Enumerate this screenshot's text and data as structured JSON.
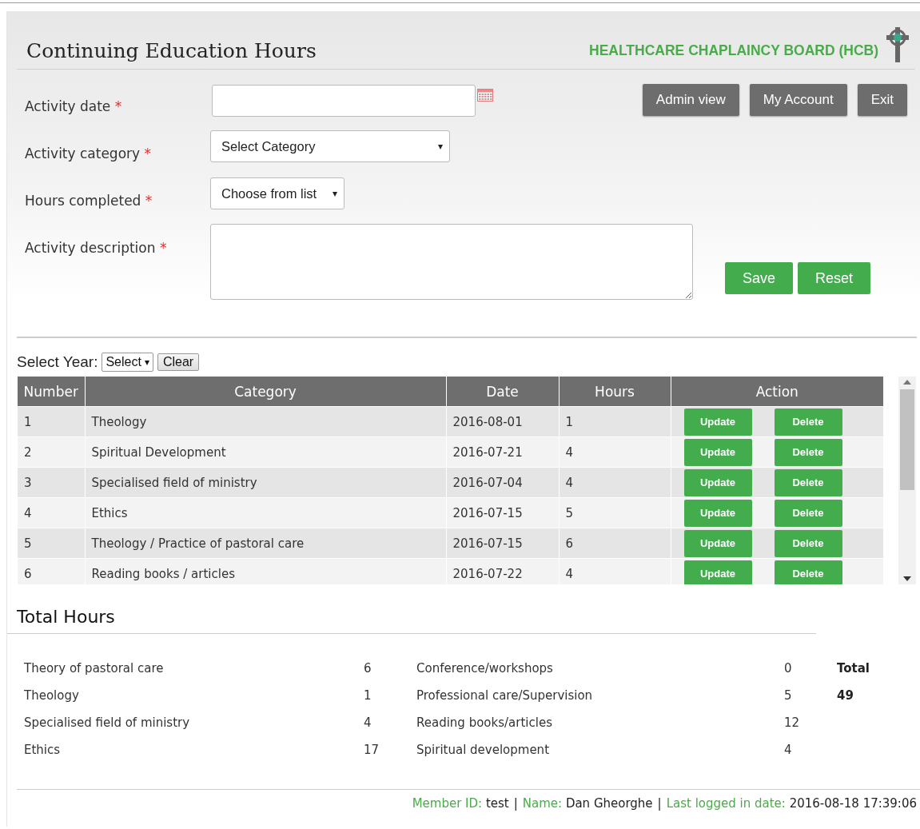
{
  "header": {
    "title": "Continuing Education Hours",
    "org_name": "HEALTHCARE CHAPLAINCY BOARD (HCB)"
  },
  "nav_buttons": [
    "Admin view",
    "My Account",
    "Exit"
  ],
  "form": {
    "fields": [
      {
        "kind": "date",
        "label": "Activity date",
        "required_mark": "*"
      },
      {
        "kind": "select",
        "label": "Activity category",
        "required_mark": "*",
        "value": "Select Category",
        "caret": "▾"
      },
      {
        "kind": "select_small",
        "label": "Hours completed",
        "required_mark": "*",
        "value": "Choose from list",
        "caret": "▾"
      },
      {
        "kind": "textarea",
        "label": "Activity description",
        "required_mark": "*"
      }
    ],
    "buttons": [
      "Save",
      "Reset"
    ]
  },
  "filter": {
    "label": "Select Year:",
    "select_value": "Select",
    "caret": "▾",
    "clear_button": "Clear"
  },
  "table": {
    "columns": [
      "Number",
      "Category",
      "Date",
      "Hours",
      "Action"
    ],
    "rows": [
      {
        "number": "1",
        "category": "Theology",
        "date": "2016-08-01",
        "hours": "1",
        "actions": [
          "Update",
          "Delete"
        ]
      },
      {
        "number": "2",
        "category": "Spiritual Development",
        "date": "2016-07-21",
        "hours": "4",
        "actions": [
          "Update",
          "Delete"
        ]
      },
      {
        "number": "3",
        "category": "Specialised field of ministry",
        "date": "2016-07-04",
        "hours": "4",
        "actions": [
          "Update",
          "Delete"
        ]
      },
      {
        "number": "4",
        "category": "Ethics",
        "date": "2016-07-15",
        "hours": "5",
        "actions": [
          "Update",
          "Delete"
        ]
      },
      {
        "number": "5",
        "category": "Theology / Practice of pastoral care",
        "date": "2016-07-15",
        "hours": "6",
        "actions": [
          "Update",
          "Delete"
        ]
      },
      {
        "number": "6",
        "category": "Reading books / articles",
        "date": "2016-07-22",
        "hours": "4",
        "actions": [
          "Update",
          "Delete"
        ]
      }
    ]
  },
  "totals": {
    "title": "Total Hours",
    "left": [
      {
        "label": "Theory of pastoral care",
        "value": "6"
      },
      {
        "label": "Theology",
        "value": "1"
      },
      {
        "label": "Specialised field of ministry",
        "value": "4"
      },
      {
        "label": "Ethics",
        "value": "17"
      }
    ],
    "right": [
      {
        "label": "Conference/workshops",
        "value": "0"
      },
      {
        "label": "Professional care/Supervision",
        "value": "5"
      },
      {
        "label": "Reading books/articles",
        "value": "12"
      },
      {
        "label": "Spiritual development",
        "value": "4"
      }
    ],
    "total_label": "Total",
    "total_value": "49"
  },
  "footer": [
    {
      "label": "Member ID:",
      "value": "test"
    },
    {
      "label": "Name:",
      "value": "Dan Gheorghe"
    },
    {
      "label": "Last logged in date:",
      "value": "2016-08-18 17:39:06"
    }
  ],
  "footer_separator": "|"
}
